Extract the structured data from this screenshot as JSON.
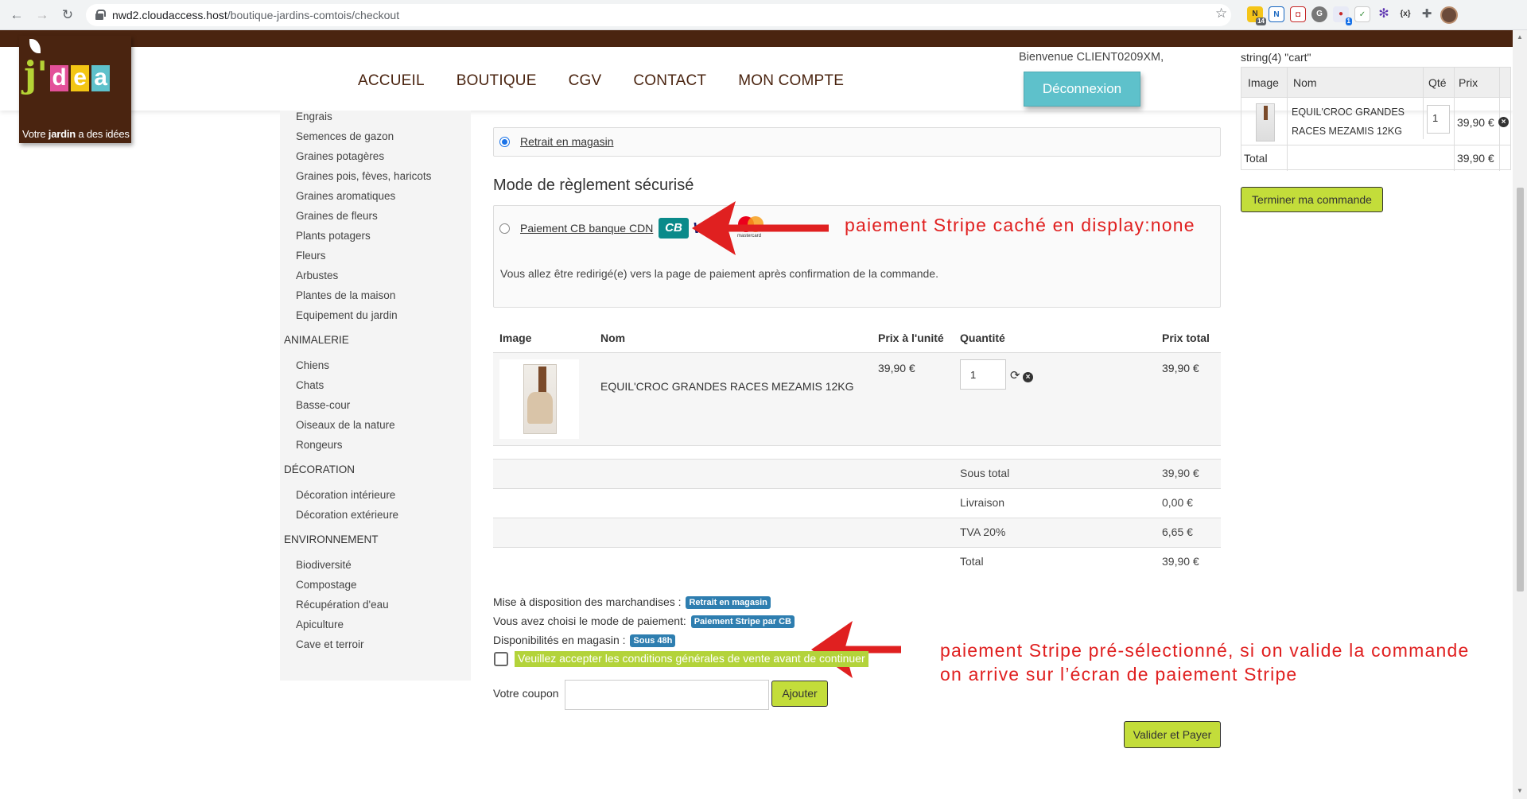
{
  "browser": {
    "url_host": "nwd2.cloudaccess.host",
    "url_path": "/boutique-jardins-comtois/checkout",
    "ext_badge_1": "14",
    "ext_badge_2": "1"
  },
  "logo": {
    "letters": [
      "j'",
      "d",
      "e",
      "a"
    ],
    "tag_pre": "Votre ",
    "tag_bold": "jardin",
    "tag_post": " a des idées"
  },
  "nav": [
    "ACCUEIL",
    "BOUTIQUE",
    "CGV",
    "CONTACT",
    "MON COMPTE"
  ],
  "user": {
    "welcome": "Bienvenue CLIENT0209XM,",
    "logout": "Déconnexion"
  },
  "sidebar": [
    {
      "cat": "",
      "items": [
        "Engrais",
        "Semences de gazon",
        "Graines potagères",
        "Graines pois, fèves, haricots",
        "Graines aromatiques",
        "Graines de fleurs",
        "Plants potagers",
        "Fleurs",
        "Arbustes",
        "Plantes de la maison",
        "Equipement du jardin"
      ]
    },
    {
      "cat": "ANIMALERIE",
      "items": [
        "Chiens",
        "Chats",
        "Basse-cour",
        "Oiseaux de la nature",
        "Rongeurs"
      ]
    },
    {
      "cat": "DÉCORATION",
      "items": [
        "Décoration intérieure",
        "Décoration extérieure"
      ]
    },
    {
      "cat": "ENVIRONNEMENT",
      "items": [
        "Biodiversité",
        "Compostage",
        "Récupération d'eau",
        "Apiculture",
        "Cave et terroir"
      ]
    }
  ],
  "checkout": {
    "shipping_option": "Retrait en magasin",
    "payment_title": "Mode de règlement sécurisé",
    "payment_option": "Paiement CB banque CDN",
    "card_cb": "CB",
    "card_visa": "VISA",
    "card_mc": "mastercard",
    "redirect_note": "Vous allez être redirigé(e) vers la page de paiement après confirmation de la commande.",
    "headers": {
      "image": "Image",
      "name": "Nom",
      "unit": "Prix à l'unité",
      "qty": "Quantité",
      "total": "Prix total"
    },
    "product": {
      "name": "EQUIL'CROC GRANDES RACES MEZAMIS 12KG",
      "unit_price": "39,90 €",
      "qty": "1",
      "total": "39,90 €"
    },
    "summary": [
      {
        "label": "Sous total",
        "value": "39,90 €"
      },
      {
        "label": "Livraison",
        "value": "0,00 €"
      },
      {
        "label": "TVA 20%",
        "value": "6,65 €"
      },
      {
        "label": "Total",
        "value": "39,90 €"
      }
    ],
    "info": [
      {
        "text": "Mise à disposition des marchandises :",
        "pill": "Retrait en magasin"
      },
      {
        "text": "Vous avez choisi le mode de paiement:",
        "pill": "Paiement Stripe par CB"
      },
      {
        "text": "Disponibilités en magasin :",
        "pill": "Sous 48h"
      }
    ],
    "cgv_notice": "Veuillez accepter les conditions générales de vente avant de continuer",
    "coupon_label": "Votre coupon",
    "coupon_button": "Ajouter",
    "submit_button": "Valider et Payer"
  },
  "annotations": {
    "stripe_hidden": "paiement Stripe caché en display:none",
    "stripe_preselected_1": "paiement Stripe pré-sélectionné, si on valide la commande",
    "stripe_preselected_2": "on arrive sur l’écran de paiement Stripe",
    "arrow_color": "#e02020"
  },
  "cart": {
    "dump": "string(4) \"cart\"",
    "headers": {
      "image": "Image",
      "name": "Nom",
      "qty": "Qté",
      "price": "Prix"
    },
    "item_name_1": "EQUIL'CROC GRANDES",
    "item_name_2": "RACES MEZAMIS 12KG",
    "item_qty": "1",
    "item_price": "39,90 €",
    "total_label": "Total",
    "total_value": "39,90 €",
    "checkout_button": "Terminer ma commande"
  }
}
